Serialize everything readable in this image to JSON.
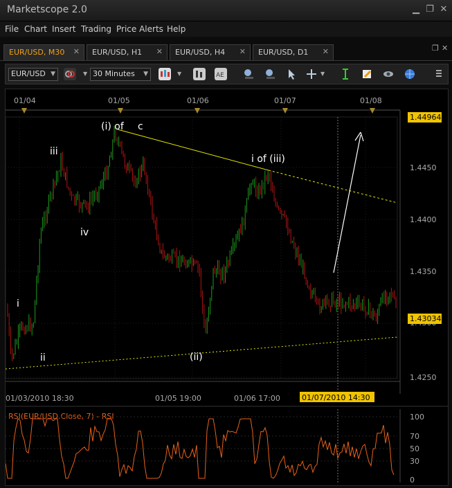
{
  "app": {
    "title": "Marketscope 2.0"
  },
  "menu": [
    "File",
    "Chart",
    "Insert",
    "Trading",
    "Price Alerts",
    "Help"
  ],
  "tabs": [
    {
      "label": "EUR/USD, M30",
      "active": true
    },
    {
      "label": "EUR/USD, H1",
      "active": false
    },
    {
      "label": "EUR/USD, H4",
      "active": false
    },
    {
      "label": "EUR/USD, D1",
      "active": false
    }
  ],
  "toolbar": {
    "instrument": "EUR/USD",
    "timeframe": "30 Minutes"
  },
  "chart": {
    "top_dates": [
      "01/04",
      "01/05",
      "01/06",
      "01/07",
      "01/08"
    ],
    "price_labels": [
      "1.4450",
      "1.4400",
      "1.4350",
      "1.4300",
      "1.4250"
    ],
    "high_marker": "1.44964",
    "current_marker": "1.43034",
    "time_labels": [
      "01/03/2010 18:30",
      "01/05 19:00",
      "01/06 17:00"
    ],
    "crosshair_time": "01/07/2010 14:30",
    "annotations": [
      "(i) of",
      "c",
      "iii",
      "iv",
      "i",
      "ii",
      "(ii)",
      "i of (iii)"
    ]
  },
  "rsi": {
    "title": "RSI(EUR/USD.Close, 7) - RSI",
    "levels": [
      "100",
      "70",
      "50",
      "30",
      "0"
    ]
  },
  "colors": {
    "accent": "#f0a11b",
    "bull_candle": "#1c9c1c",
    "bear_candle": "#b01414",
    "rsi_line": "#e8621a",
    "trendline": "#e8e800"
  }
}
